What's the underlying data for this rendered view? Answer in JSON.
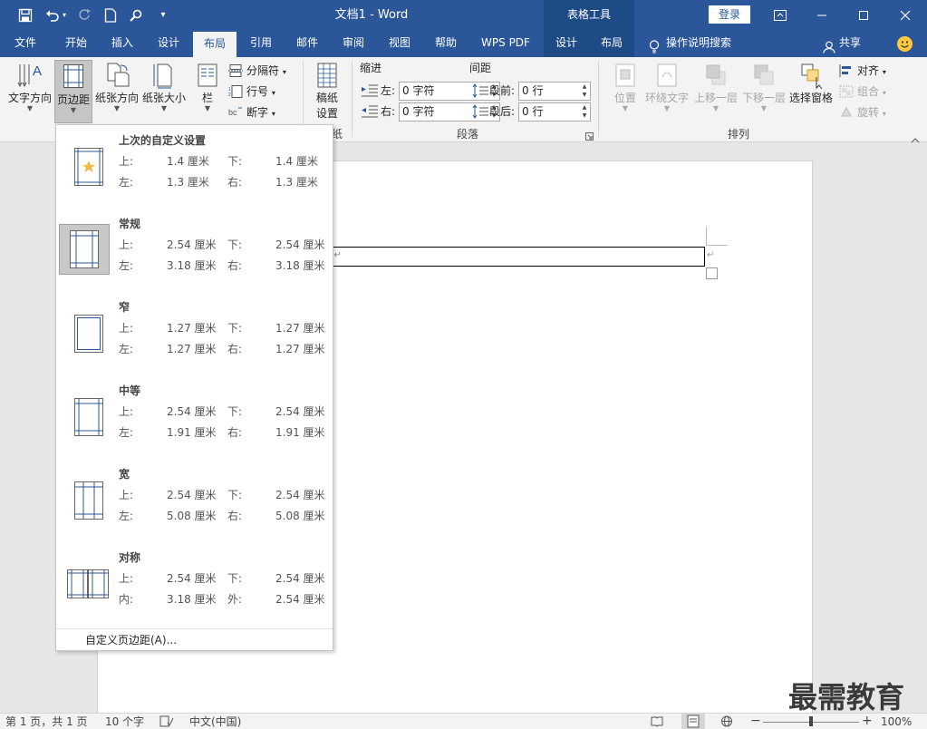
{
  "titlebar": {
    "doc_title": "文档1  -  Word",
    "context_tab": "表格工具",
    "login": "登录"
  },
  "tabs": [
    {
      "label": "文件"
    },
    {
      "label": "开始"
    },
    {
      "label": "插入"
    },
    {
      "label": "设计"
    },
    {
      "label": "布局",
      "active": true
    },
    {
      "label": "引用"
    },
    {
      "label": "邮件"
    },
    {
      "label": "审阅"
    },
    {
      "label": "视图"
    },
    {
      "label": "帮助"
    },
    {
      "label": "WPS PDF"
    },
    {
      "label": "设计"
    },
    {
      "label": "布局"
    }
  ],
  "tell_me": "操作说明搜索",
  "share": "共享",
  "ribbon": {
    "text_direction": "文字方向",
    "margins": "页边距",
    "orientation": "纸张方向",
    "size": "纸张大小",
    "columns": "栏",
    "breaks": "分隔符",
    "line_numbers": "行号",
    "hyphenation": "断字",
    "manuscript_line1": "稿纸",
    "manuscript_line2": "设置",
    "indent_label": "缩进",
    "spacing_label": "间距",
    "indent_left_label": "左:",
    "indent_left_value": "0 字符",
    "indent_right_label": "右:",
    "indent_right_value": "0 字符",
    "spacing_before_label": "段前:",
    "spacing_before_value": "0 行",
    "spacing_after_label": "段后:",
    "spacing_after_value": "0 行",
    "paragraph_group": "段落",
    "manuscript_group_tail": "纸",
    "position": "位置",
    "wrap_text": "环绕文字",
    "bring_forward": "上移一层",
    "send_backward": "下移一层",
    "selection_pane": "选择窗格",
    "align": "对齐",
    "group": "组合",
    "rotate": "旋转",
    "arrange_group": "排列"
  },
  "margins_menu": {
    "presets": [
      {
        "title": "上次的自定义设置",
        "l1": "上:",
        "v1": "1.4 厘米",
        "l2": "下:",
        "v2": "1.4 厘米",
        "l3": "左:",
        "v3": "1.3 厘米",
        "l4": "右:",
        "v4": "1.3 厘米"
      },
      {
        "title": "常规",
        "l1": "上:",
        "v1": "2.54 厘米",
        "l2": "下:",
        "v2": "2.54 厘米",
        "l3": "左:",
        "v3": "3.18 厘米",
        "l4": "右:",
        "v4": "3.18 厘米"
      },
      {
        "title": "窄",
        "l1": "上:",
        "v1": "1.27 厘米",
        "l2": "下:",
        "v2": "1.27 厘米",
        "l3": "左:",
        "v3": "1.27 厘米",
        "l4": "右:",
        "v4": "1.27 厘米"
      },
      {
        "title": "中等",
        "l1": "上:",
        "v1": "2.54 厘米",
        "l2": "下:",
        "v2": "2.54 厘米",
        "l3": "左:",
        "v3": "1.91 厘米",
        "l4": "右:",
        "v4": "1.91 厘米"
      },
      {
        "title": "宽",
        "l1": "上:",
        "v1": "2.54 厘米",
        "l2": "下:",
        "v2": "2.54 厘米",
        "l3": "左:",
        "v3": "5.08 厘米",
        "l4": "右:",
        "v4": "5.08 厘米"
      },
      {
        "title": "对称",
        "l1": "上:",
        "v1": "2.54 厘米",
        "l2": "下:",
        "v2": "2.54 厘米",
        "l3": "内:",
        "v3": "3.18 厘米",
        "l4": "外:",
        "v4": "2.54 厘米"
      }
    ],
    "custom": "自定义页边距(A)..."
  },
  "status": {
    "page": "第 1 页，共 1 页",
    "words": "10 个字",
    "language": "中文(中国)",
    "zoom": "100%"
  },
  "watermark": "最需教育"
}
